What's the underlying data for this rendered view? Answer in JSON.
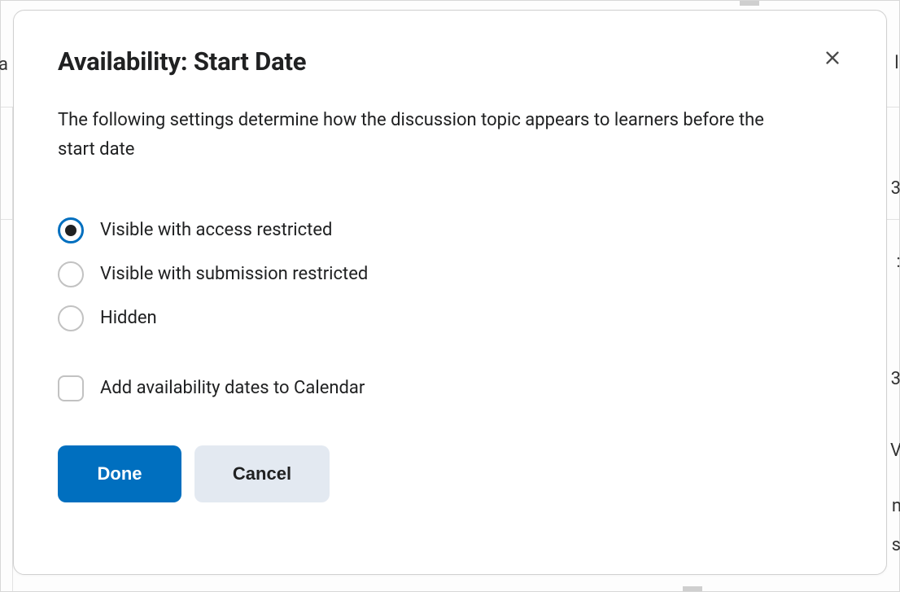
{
  "dialog": {
    "title": "Availability: Start Date",
    "description": "The following settings determine how the discussion topic appears to learners before the start date",
    "options": [
      {
        "label": "Visible with access restricted",
        "selected": true
      },
      {
        "label": "Visible with submission restricted",
        "selected": false
      },
      {
        "label": "Hidden",
        "selected": false
      }
    ],
    "checkbox": {
      "label": "Add availability dates to Calendar",
      "checked": false
    },
    "buttons": {
      "primary": "Done",
      "secondary": "Cancel"
    }
  },
  "background": {
    "frag_left": "a",
    "frag_li": "li",
    "frag_3a": "3",
    "frag_colon": "::",
    "frag_3b": "3",
    "frag_v": "V",
    "frag_n": "n",
    "frag_s": "s"
  }
}
